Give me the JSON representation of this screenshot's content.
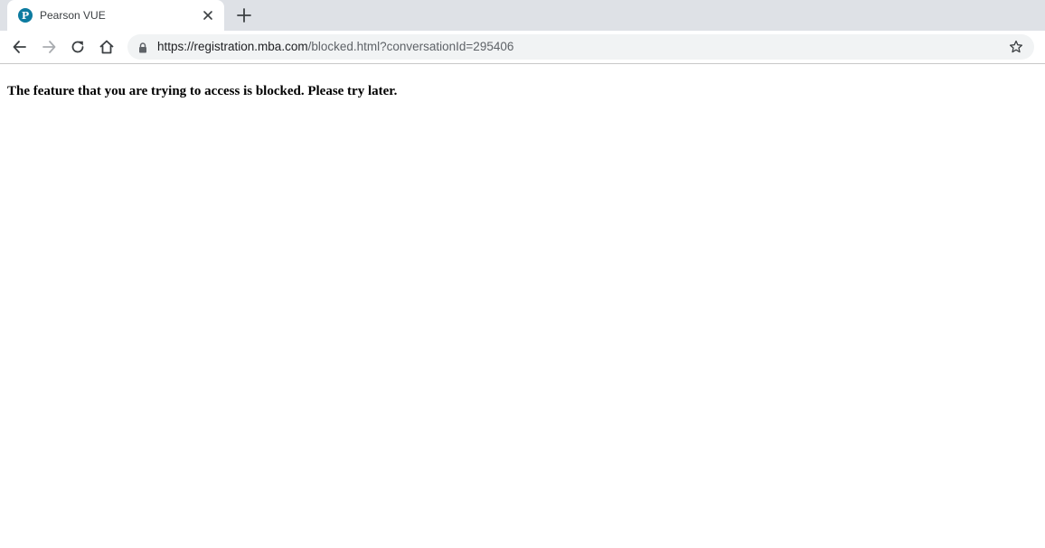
{
  "browser": {
    "tab": {
      "title": "Pearson VUE",
      "favicon_letter": "P",
      "favicon_icon": "pearson-logo-icon"
    },
    "new_tab_icon": "plus-icon",
    "close_tab_icon": "close-icon",
    "toolbar": {
      "back_icon": "arrow-left-icon",
      "forward_icon": "arrow-right-icon",
      "reload_icon": "reload-icon",
      "home_icon": "home-icon",
      "bookmark_icon": "star-icon"
    },
    "address_bar": {
      "lock_icon": "lock-icon",
      "url_host": "https://registration.mba.com",
      "url_path": "/blocked.html?conversationId=295406"
    }
  },
  "page": {
    "message": "The feature that you are trying to access is blocked. Please try later."
  },
  "colors": {
    "tab_strip": "#dee1e6",
    "omnibox": "#f1f3f4",
    "favicon": "#0c7ba0"
  }
}
